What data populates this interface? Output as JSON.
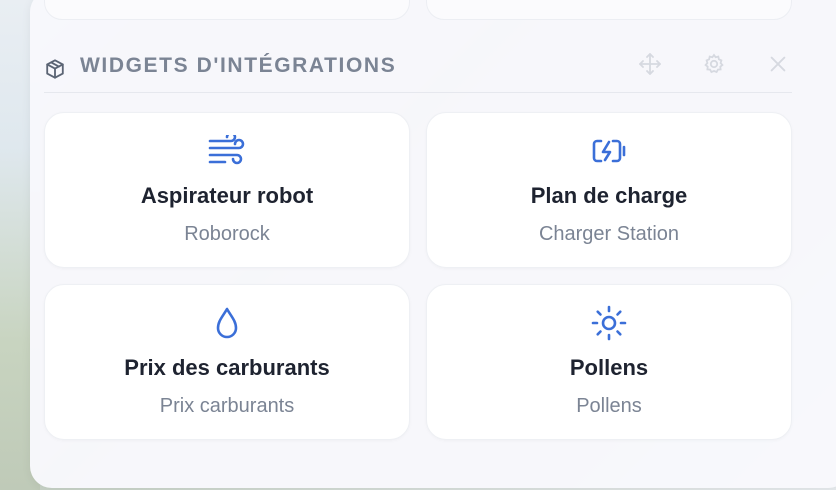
{
  "section": {
    "title": "WIDGETS D'INTÉGRATIONS",
    "icon": "cube-icon"
  },
  "header_actions": [
    {
      "name": "move-icon"
    },
    {
      "name": "settings-icon"
    },
    {
      "name": "close-icon"
    }
  ],
  "accent_color": "#3b6fd8",
  "widgets": [
    {
      "title": "Aspirateur robot",
      "subtitle": "Roborock",
      "icon": "wind-icon"
    },
    {
      "title": "Plan de charge",
      "subtitle": "Charger Station",
      "icon": "battery-charging-icon"
    },
    {
      "title": "Prix des carburants",
      "subtitle": "Prix carburants",
      "icon": "droplet-icon"
    },
    {
      "title": "Pollens",
      "subtitle": "Pollens",
      "icon": "sun-icon"
    }
  ]
}
